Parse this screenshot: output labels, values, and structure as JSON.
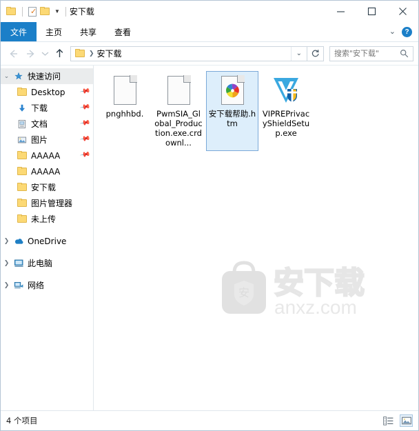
{
  "window": {
    "title": "安下载",
    "quick_access_toolbar": [
      {
        "name": "folder-properties-group",
        "icon": "folder-icon"
      },
      {
        "name": "properties",
        "icon": "document-check-icon"
      },
      {
        "name": "new-folder",
        "icon": "folder-icon"
      },
      {
        "name": "customize",
        "icon": "chevron-down-icon"
      }
    ],
    "controls": {
      "minimize": "minimize-icon",
      "maximize": "maximize-icon",
      "close": "close-icon"
    }
  },
  "ribbon": {
    "tabs": [
      {
        "label": "文件",
        "active": true
      },
      {
        "label": "主页",
        "active": false
      },
      {
        "label": "共享",
        "active": false
      },
      {
        "label": "查看",
        "active": false
      }
    ],
    "expand_icon": "chevron-down-icon",
    "help_label": "?"
  },
  "address_bar": {
    "back": "arrow-left-icon",
    "forward": "arrow-right-icon",
    "recent": "chevron-down-icon",
    "up": "arrow-up-icon",
    "breadcrumb": [
      "安下载"
    ],
    "dropdown_icon": "chevron-down-icon",
    "refresh_icon": "refresh-icon"
  },
  "search": {
    "placeholder": "搜索\"安下载\"",
    "value": "",
    "icon": "search-icon"
  },
  "sidebar": {
    "items": [
      {
        "label": "快速访问",
        "icon": "star-pin-icon",
        "indent": 0,
        "expander": "chevron-down",
        "selected": true,
        "pinned": false
      },
      {
        "label": "Desktop",
        "icon": "folder-icon",
        "indent": 1,
        "expander": "",
        "selected": false,
        "pinned": true
      },
      {
        "label": "下载",
        "icon": "download-icon",
        "indent": 1,
        "expander": "",
        "selected": false,
        "pinned": true
      },
      {
        "label": "文档",
        "icon": "documents-icon",
        "indent": 1,
        "expander": "",
        "selected": false,
        "pinned": true
      },
      {
        "label": "图片",
        "icon": "pictures-icon",
        "indent": 1,
        "expander": "",
        "selected": false,
        "pinned": true
      },
      {
        "label": "AAAAA",
        "icon": "folder-icon",
        "indent": 1,
        "expander": "",
        "selected": false,
        "pinned": true
      },
      {
        "label": "AAAAA",
        "icon": "folder-icon",
        "indent": 1,
        "expander": "",
        "selected": false,
        "pinned": false
      },
      {
        "label": "安下载",
        "icon": "folder-icon",
        "indent": 1,
        "expander": "",
        "selected": false,
        "pinned": false
      },
      {
        "label": "图片管理器",
        "icon": "folder-icon",
        "indent": 1,
        "expander": "",
        "selected": false,
        "pinned": false
      },
      {
        "label": "未上传",
        "icon": "folder-icon",
        "indent": 1,
        "expander": "",
        "selected": false,
        "pinned": false
      },
      {
        "label": "OneDrive",
        "icon": "onedrive-icon",
        "indent": 0,
        "expander": "chevron-right",
        "selected": false,
        "pinned": false
      },
      {
        "label": "此电脑",
        "icon": "this-pc-icon",
        "indent": 0,
        "expander": "chevron-right",
        "selected": false,
        "pinned": false
      },
      {
        "label": "网络",
        "icon": "network-icon",
        "indent": 0,
        "expander": "chevron-right",
        "selected": false,
        "pinned": false
      }
    ]
  },
  "files": [
    {
      "name": "pnghhbd.",
      "icon": "blank-document-icon",
      "selected": false
    },
    {
      "name": "PwmSIA_Global_Production.exe.crdownl...",
      "icon": "blank-document-icon",
      "selected": false
    },
    {
      "name": "安下载帮助.htm",
      "icon": "html-pinwheel-icon",
      "selected": true
    },
    {
      "name": "VIPREPrivacyShieldSetup.exe",
      "icon": "vipre-shield-icon",
      "selected": false
    }
  ],
  "watermark": {
    "logo_char": "安",
    "brand": "安下载",
    "domain": "anxz.com"
  },
  "status_bar": {
    "item_count": "4 个项目",
    "views": [
      {
        "name": "details-view",
        "icon": "details-view-icon",
        "active": false
      },
      {
        "name": "large-icons-view",
        "icon": "large-icons-view-icon",
        "active": true
      }
    ]
  },
  "colors": {
    "accent": "#1b7fc8",
    "selection_fill": "#ddeefb",
    "selection_border": "#7aa9d8",
    "folder": "#fcd975",
    "window_border": "#b4c4d4"
  }
}
